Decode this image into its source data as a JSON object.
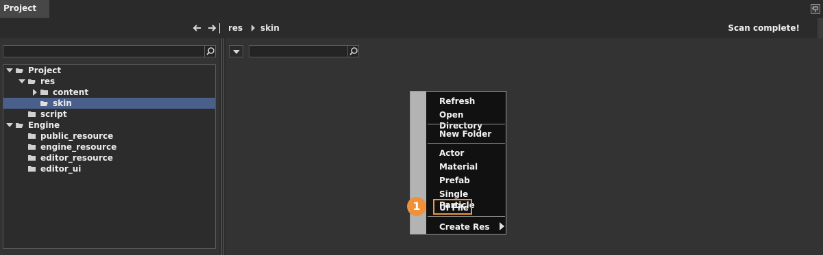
{
  "tab": {
    "title": "Project"
  },
  "nav": {
    "breadcrumb": [
      "res",
      "skin"
    ],
    "status": "Scan complete!"
  },
  "tree": {
    "items": [
      {
        "label": "Project",
        "expanded": true,
        "selected": false
      },
      {
        "label": "res",
        "expanded": true,
        "selected": false
      },
      {
        "label": "content",
        "expanded": false,
        "selected": false
      },
      {
        "label": "skin",
        "expanded": false,
        "selected": true
      },
      {
        "label": "script",
        "expanded": false,
        "selected": false
      },
      {
        "label": "Engine",
        "expanded": true,
        "selected": false
      },
      {
        "label": "public_resource",
        "expanded": false,
        "selected": false
      },
      {
        "label": "engine_resource",
        "expanded": false,
        "selected": false
      },
      {
        "label": "editor_resource",
        "expanded": false,
        "selected": false
      },
      {
        "label": "editor_ui",
        "expanded": false,
        "selected": false
      }
    ]
  },
  "context_menu": {
    "items": [
      "Refresh",
      "Open Directory",
      "New Folder",
      "Actor",
      "Material",
      "Prefab",
      "Single Particle",
      "UI File",
      "Create Res"
    ],
    "highlighted": "UI File",
    "callout_number": "1"
  },
  "colors": {
    "accent_orange": "#f0913a",
    "selection_blue": "#4a5f8a",
    "menu_gutter": "#b3b3b3"
  }
}
